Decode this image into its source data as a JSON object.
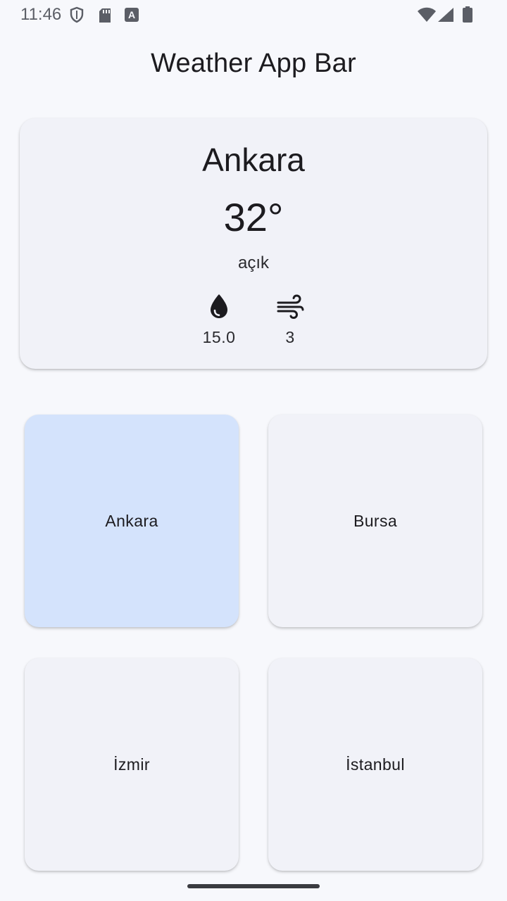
{
  "status_bar": {
    "time": "11:46",
    "left_icons": [
      "shield-icon",
      "sd-card-icon",
      "font-a-icon"
    ],
    "right_icons": [
      "wifi-icon",
      "cellular-signal-icon",
      "battery-icon"
    ]
  },
  "app_bar": {
    "title": "Weather App Bar"
  },
  "current_weather": {
    "city": "Ankara",
    "temperature": "32°",
    "description": "açık",
    "humidity_icon": "water-drop-icon",
    "humidity": "15.0",
    "wind_icon": "wind-icon",
    "wind": "3"
  },
  "cities": [
    {
      "name": "Ankara",
      "selected": true
    },
    {
      "name": "Bursa",
      "selected": false
    },
    {
      "name": "İzmir",
      "selected": false
    },
    {
      "name": "İstanbul",
      "selected": false
    }
  ],
  "colors": {
    "background": "#f7f8fc",
    "card": "#f1f2f8",
    "selected_tile": "#d4e3fc",
    "text": "#1c1b1f"
  }
}
